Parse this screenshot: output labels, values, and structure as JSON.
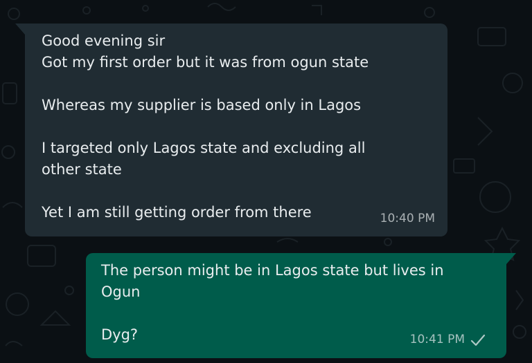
{
  "chat": {
    "incoming": {
      "lines": [
        "Good evening sir",
        "Got my first order but it was from ogun state",
        "Whereas my supplier is based only in Lagos",
        "I targeted only Lagos state and excluding all",
        "other state",
        "Yet I am still getting order from there"
      ],
      "time": "10:40 PM"
    },
    "outgoing": {
      "lines": [
        "The person might be in Lagos state but lives in",
        "Ogun",
        "Dyg?"
      ],
      "time": "10:41 PM",
      "status_icon": "single-check-icon"
    }
  },
  "colors": {
    "background": "#0b1014",
    "incoming_bubble": "#202c33",
    "outgoing_bubble": "#005c4b",
    "text": "#e9edef"
  }
}
